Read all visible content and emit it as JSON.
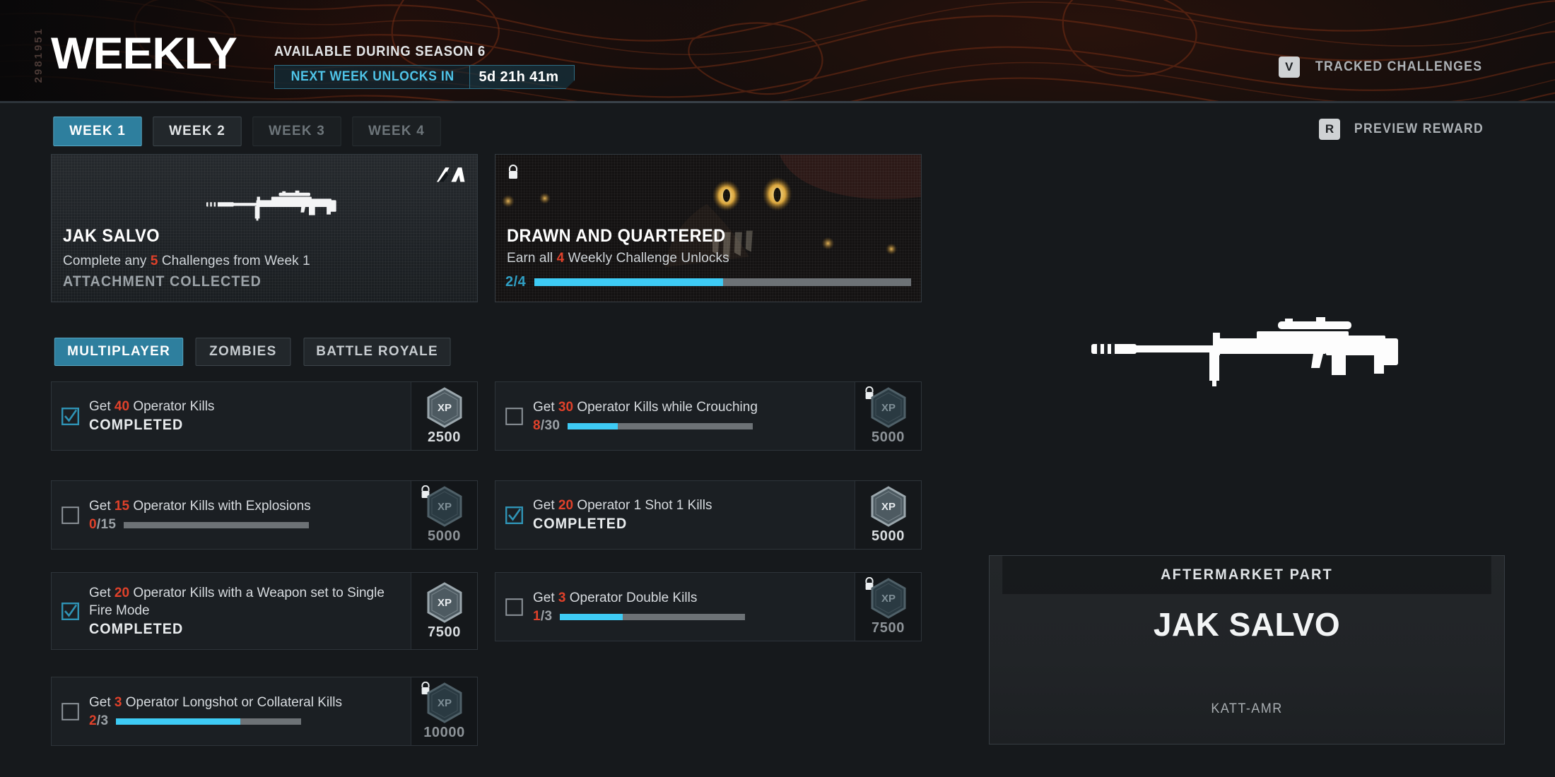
{
  "header": {
    "serial": "2981951",
    "title": "WEEKLY",
    "available_text": "AVAILABLE DURING SEASON 6",
    "unlock_label": "NEXT WEEK UNLOCKS IN",
    "unlock_time": "5d 21h 41m",
    "tracked_key": "V",
    "tracked_label": "TRACKED CHALLENGES"
  },
  "nav": {
    "week_tabs": [
      {
        "label": "WEEK 1",
        "state": "active"
      },
      {
        "label": "WEEK 2",
        "state": "idle"
      },
      {
        "label": "WEEK 3",
        "state": "dim"
      },
      {
        "label": "WEEK 4",
        "state": "dim"
      }
    ],
    "preview_key": "R",
    "preview_label": "PREVIEW REWARD",
    "mode_tabs": [
      {
        "label": "MULTIPLAYER",
        "state": "active"
      },
      {
        "label": "ZOMBIES",
        "state": "idle"
      },
      {
        "label": "BATTLE ROYALE",
        "state": "idle"
      }
    ]
  },
  "reward_cards": [
    {
      "title": "JAK SALVO",
      "sub_pre": "Complete any ",
      "sub_num": "5",
      "sub_post": " Challenges from Week 1",
      "state": "ATTACHMENT COLLECTED",
      "locked": false
    },
    {
      "title": "DRAWN AND QUARTERED",
      "sub_pre": "Earn all ",
      "sub_num": "4",
      "sub_post": " Weekly Challenge Unlocks",
      "progress_text": "2/4",
      "progress_current": 2,
      "progress_total": 4,
      "locked": true
    }
  ],
  "challenges_left": [
    {
      "pre": "Get ",
      "num": "40",
      "post": " Operator Kills",
      "status": "COMPLETED",
      "completed": true,
      "locked": false,
      "xp": "2500"
    },
    {
      "pre": "Get ",
      "num": "15",
      "post": " Operator Kills with Explosions",
      "completed": false,
      "locked": true,
      "progress_current": "0",
      "progress_total": "15",
      "progress_pct": 0,
      "xp": "5000"
    },
    {
      "pre": "Get ",
      "num": "20",
      "post": " Operator Kills with a Weapon set to Single Fire Mode",
      "status": "COMPLETED",
      "completed": true,
      "locked": false,
      "xp": "7500"
    },
    {
      "pre": "Get ",
      "num": "3",
      "post": " Operator Longshot or Collateral Kills",
      "completed": false,
      "locked": true,
      "progress_current": "2",
      "progress_total": "3",
      "progress_pct": 67,
      "xp": "10000"
    }
  ],
  "challenges_right": [
    {
      "pre": "Get ",
      "num": "30",
      "post": " Operator Kills while Crouching",
      "completed": false,
      "locked": true,
      "progress_current": "8",
      "progress_total": "30",
      "progress_pct": 27,
      "xp": "5000"
    },
    {
      "pre": "Get ",
      "num": "20",
      "post": " Operator 1 Shot 1 Kills",
      "status": "COMPLETED",
      "completed": true,
      "locked": false,
      "xp": "5000"
    },
    {
      "pre": "Get ",
      "num": "3",
      "post": " Operator Double Kills",
      "completed": false,
      "locked": true,
      "progress_current": "1",
      "progress_total": "3",
      "progress_pct": 34,
      "xp": "7500"
    }
  ],
  "right_panel": {
    "kicker": "AFTERMARKET PART",
    "name": "JAK SALVO",
    "weapon": "KATT-AMR"
  },
  "colors": {
    "accent_teal": "#2e7f9e",
    "progress_blue": "#3ecbf5",
    "highlight_red": "#e0412a",
    "panel_bg": "#1b1f23"
  }
}
